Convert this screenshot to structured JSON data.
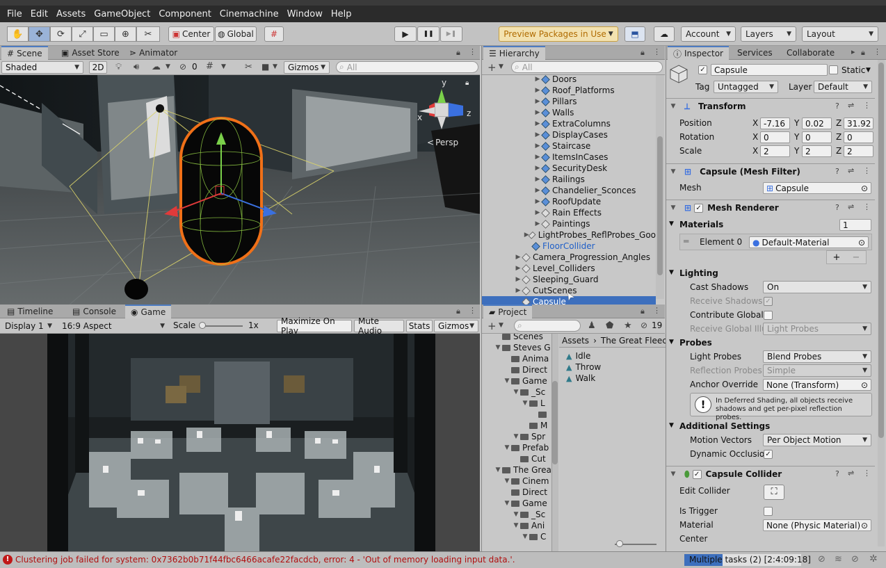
{
  "menu": [
    "File",
    "Edit",
    "Assets",
    "GameObject",
    "Component",
    "Cinemachine",
    "Window",
    "Help"
  ],
  "toolbar": {
    "tools": [
      "hand-tool",
      "move-tool",
      "rotate-tool",
      "scale-tool",
      "rect-tool",
      "transform-tool",
      "custom-tool"
    ],
    "tool_icons": [
      "✋",
      "✥",
      "⟳",
      "⤢",
      "▭",
      "⊕",
      "✂"
    ],
    "pivot": "Center",
    "space": "Global",
    "play": "▶",
    "pause": "❚❚",
    "step": "▶❚",
    "preview_packages": "Preview Packages in Use",
    "account": "Account",
    "layers": "Layers",
    "layout": "Layout"
  },
  "scene": {
    "tabs": [
      "Scene",
      "Asset Store",
      "Animator"
    ],
    "shading": "Shaded",
    "mode2d": "2D",
    "hidden_count": "0",
    "gizmos": "Gizmos",
    "search_placeholder": "All",
    "persp": "Persp",
    "axis_x": "x",
    "axis_y": "y",
    "axis_z": "z"
  },
  "game": {
    "tabs": [
      "Timeline",
      "Console",
      "Game"
    ],
    "display": "Display 1",
    "aspect": "16:9 Aspect",
    "scale_label": "Scale",
    "scale_value": "1x",
    "buttons": [
      "Maximize On Play",
      "Mute Audio",
      "Stats",
      "Gizmos"
    ]
  },
  "hierarchy": {
    "title": "Hierarchy",
    "search_placeholder": "All",
    "items": [
      {
        "label": "Doors",
        "depth": 2,
        "blue": true
      },
      {
        "label": "Roof_Platforms",
        "depth": 2,
        "blue": true
      },
      {
        "label": "Pillars",
        "depth": 2,
        "blue": true
      },
      {
        "label": "Walls",
        "depth": 2,
        "blue": true
      },
      {
        "label": "ExtraColumns",
        "depth": 2,
        "blue": true
      },
      {
        "label": "DisplayCases",
        "depth": 2,
        "blue": true
      },
      {
        "label": "Staircase",
        "depth": 2,
        "blue": true
      },
      {
        "label": "ItemsInCases",
        "depth": 2,
        "blue": true
      },
      {
        "label": "SecurityDesk",
        "depth": 2,
        "blue": true
      },
      {
        "label": "Railings",
        "depth": 2,
        "blue": true
      },
      {
        "label": "Chandelier_Sconces",
        "depth": 2,
        "blue": true
      },
      {
        "label": "RoofUpdate",
        "depth": 2,
        "blue": true
      },
      {
        "label": "Rain Effects",
        "depth": 2,
        "blue": false
      },
      {
        "label": "Paintings",
        "depth": 2,
        "blue": false
      },
      {
        "label": "LightProbes_ReflProbes_Goo",
        "depth": 1,
        "blue": false
      },
      {
        "label": "FloorCollider",
        "depth": 1,
        "blue": false,
        "link": true,
        "noarrow": true
      },
      {
        "label": "Camera_Progression_Angles",
        "depth": 0,
        "blue": false
      },
      {
        "label": "Level_Colliders",
        "depth": 0,
        "blue": false
      },
      {
        "label": "Sleeping_Guard",
        "depth": 0,
        "blue": false
      },
      {
        "label": "CutScenes",
        "depth": 0,
        "blue": false
      },
      {
        "label": "Capsule",
        "depth": 0,
        "blue": false,
        "selected": true,
        "noarrow": true
      }
    ]
  },
  "project": {
    "title": "Project",
    "hidden_count": "19",
    "tree": [
      "Scenes",
      "Steves G",
      "Anima",
      "Direct",
      "Game",
      "_Sc",
      "L",
      "",
      "M",
      "Spr",
      "Prefab",
      "Cut",
      "The Grea",
      "Cinem",
      "Direct",
      "Game",
      "_Sc",
      "Ani",
      "C"
    ],
    "breadcrumb": [
      "Assets",
      "The Great Fleece"
    ],
    "assets": [
      "Idle",
      "Throw",
      "Walk"
    ]
  },
  "inspector": {
    "tabs": [
      "Inspector",
      "Services",
      "Collaborate"
    ],
    "name": "Capsule",
    "static": "Static",
    "tag_label": "Tag",
    "tag": "Untagged",
    "layer_label": "Layer",
    "layer": "Default",
    "transform": {
      "title": "Transform",
      "rows": [
        {
          "label": "Position",
          "x": "-7.16",
          "y": "0.02",
          "z": "31.92"
        },
        {
          "label": "Rotation",
          "x": "0",
          "y": "0",
          "z": "0"
        },
        {
          "label": "Scale",
          "x": "2",
          "y": "2",
          "z": "2"
        }
      ]
    },
    "mesh_filter": {
      "title": "Capsule (Mesh Filter)",
      "mesh_label": "Mesh",
      "mesh": "Capsule"
    },
    "mesh_renderer": {
      "title": "Mesh Renderer",
      "materials_label": "Materials",
      "materials_count": "1",
      "element_label": "Element 0",
      "element_value": "Default-Material",
      "lighting_label": "Lighting",
      "cast_shadows_label": "Cast Shadows",
      "cast_shadows": "On",
      "receive_shadows_label": "Receive Shadows",
      "contribute_gi_label": "Contribute Global I",
      "receive_gi_label": "Receive Global Illu",
      "receive_gi": "Light Probes",
      "probes_label": "Probes",
      "light_probes_label": "Light Probes",
      "light_probes": "Blend Probes",
      "reflection_probes_label": "Reflection Probes",
      "reflection_probes": "Simple",
      "anchor_override_label": "Anchor Override",
      "anchor_override": "None (Transform)",
      "info": "In Deferred Shading, all objects receive shadows and get per-pixel reflection probes.",
      "additional_label": "Additional Settings",
      "motion_vectors_label": "Motion Vectors",
      "motion_vectors": "Per Object Motion",
      "dynamic_occlusion_label": "Dynamic Occlusio"
    },
    "capsule_collider": {
      "title": "Capsule Collider",
      "edit_collider_label": "Edit Collider",
      "is_trigger_label": "Is Trigger",
      "material_label": "Material",
      "material": "None (Physic Material)",
      "center_label": "Center"
    }
  },
  "status": {
    "error": "Clustering job failed for system: 0x7362b0b71f44fbc6466acafe22facdcb, error: 4 - 'Out of memory loading input data.'.",
    "tasks": "Multiple tasks (2) [2:4:09:18]"
  },
  "colors": {
    "accent": "#4d7cc2",
    "selection": "#3d6fbd",
    "error": "#c01818",
    "capsule_outline": "#f07018"
  }
}
